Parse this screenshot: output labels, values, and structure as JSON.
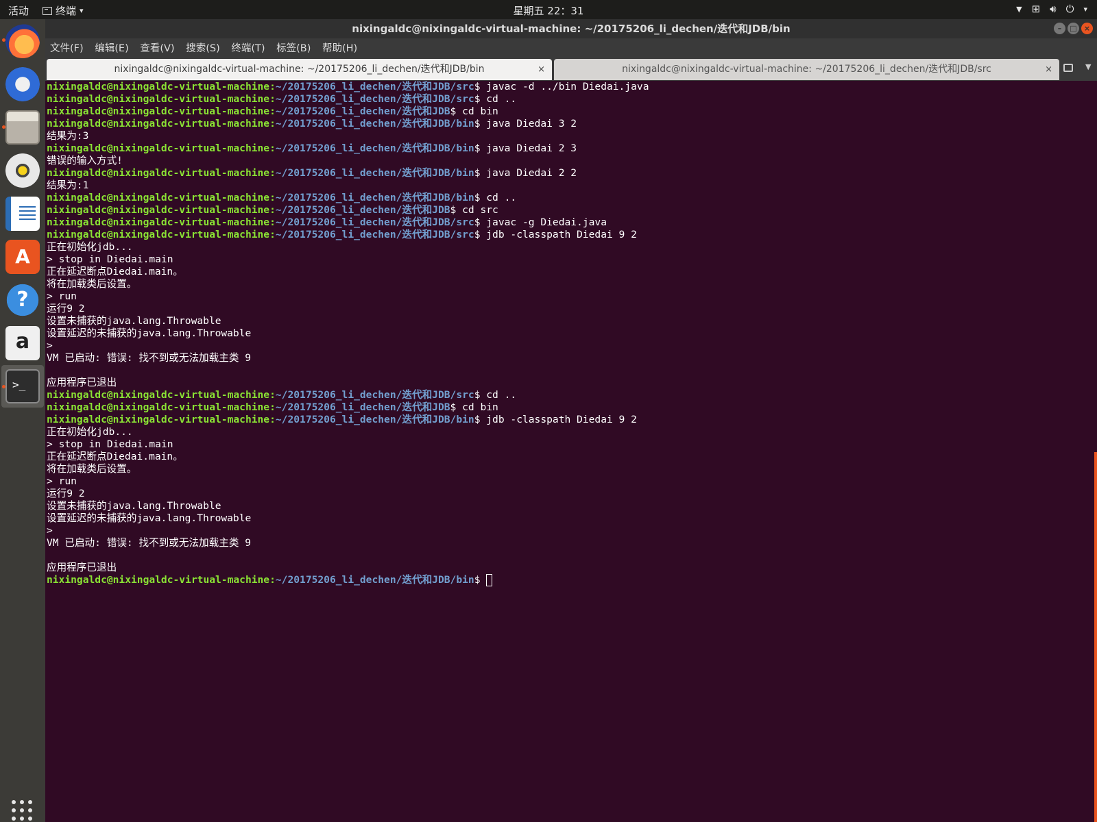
{
  "top_bar": {
    "activities": "活动",
    "app_menu": "终端",
    "clock": "星期五 22：31"
  },
  "window": {
    "title": "nixingaldc@nixingaldc-virtual-machine: ~/20175206_li_dechen/迭代和JDB/bin",
    "menu": [
      "文件(F)",
      "编辑(E)",
      "查看(V)",
      "搜索(S)",
      "终端(T)",
      "标签(B)",
      "帮助(H)"
    ],
    "tabs": [
      {
        "label": "nixingaldc@nixingaldc-virtual-machine: ~/20175206_li_dechen/迭代和JDB/bin"
      },
      {
        "label": "nixingaldc@nixingaldc-virtual-machine: ~/20175206_li_dechen/迭代和JDB/src"
      }
    ],
    "close_glyph": "×"
  },
  "dock": {
    "store_glyph": "A",
    "help_glyph": "?",
    "amazon_glyph": "a",
    "terminal_glyph": ">_"
  },
  "terminal": {
    "user": "nixingaldc@nixingaldc-virtual-machine",
    "lines": [
      {
        "p": "~/20175206_li_dechen/迭代和JDB/src",
        "c": "$ javac -d ../bin Diedai.java"
      },
      {
        "p": "~/20175206_li_dechen/迭代和JDB/src",
        "c": "$ cd .."
      },
      {
        "p": "~/20175206_li_dechen/迭代和JDB",
        "c": "$ cd bin"
      },
      {
        "p": "~/20175206_li_dechen/迭代和JDB/bin",
        "c": "$ java Diedai 3 2"
      },
      {
        "o": "结果为:3"
      },
      {
        "p": "~/20175206_li_dechen/迭代和JDB/bin",
        "c": "$ java Diedai 2 3"
      },
      {
        "o": "错误的输入方式!"
      },
      {
        "p": "~/20175206_li_dechen/迭代和JDB/bin",
        "c": "$ java Diedai 2 2"
      },
      {
        "o": "结果为:1"
      },
      {
        "p": "~/20175206_li_dechen/迭代和JDB/bin",
        "c": "$ cd .."
      },
      {
        "p": "~/20175206_li_dechen/迭代和JDB",
        "c": "$ cd src"
      },
      {
        "p": "~/20175206_li_dechen/迭代和JDB/src",
        "c": "$ javac -g Diedai.java"
      },
      {
        "p": "~/20175206_li_dechen/迭代和JDB/src",
        "c": "$ jdb -classpath Diedai 9 2"
      },
      {
        "o": "正在初始化jdb..."
      },
      {
        "o": "> stop in Diedai.main"
      },
      {
        "o": "正在延迟断点Diedai.main。"
      },
      {
        "o": "将在加载类后设置。"
      },
      {
        "o": "> run"
      },
      {
        "o": "运行9 2"
      },
      {
        "o": "设置未捕获的java.lang.Throwable"
      },
      {
        "o": "设置延迟的未捕获的java.lang.Throwable"
      },
      {
        "o": ">"
      },
      {
        "o": "VM 已启动: 错误: 找不到或无法加载主类 9"
      },
      {
        "o": ""
      },
      {
        "o": "应用程序已退出"
      },
      {
        "p": "~/20175206_li_dechen/迭代和JDB/src",
        "c": "$ cd .."
      },
      {
        "p": "~/20175206_li_dechen/迭代和JDB",
        "c": "$ cd bin"
      },
      {
        "p": "~/20175206_li_dechen/迭代和JDB/bin",
        "c": "$ jdb -classpath Diedai 9 2"
      },
      {
        "o": "正在初始化jdb..."
      },
      {
        "o": "> stop in Diedai.main"
      },
      {
        "o": "正在延迟断点Diedai.main。"
      },
      {
        "o": "将在加载类后设置。"
      },
      {
        "o": "> run"
      },
      {
        "o": "运行9 2"
      },
      {
        "o": "设置未捕获的java.lang.Throwable"
      },
      {
        "o": "设置延迟的未捕获的java.lang.Throwable"
      },
      {
        "o": ">"
      },
      {
        "o": "VM 已启动: 错误: 找不到或无法加载主类 9"
      },
      {
        "o": ""
      },
      {
        "o": "应用程序已退出"
      },
      {
        "p": "~/20175206_li_dechen/迭代和JDB/bin",
        "c": "$ ",
        "cursor": true
      }
    ]
  }
}
